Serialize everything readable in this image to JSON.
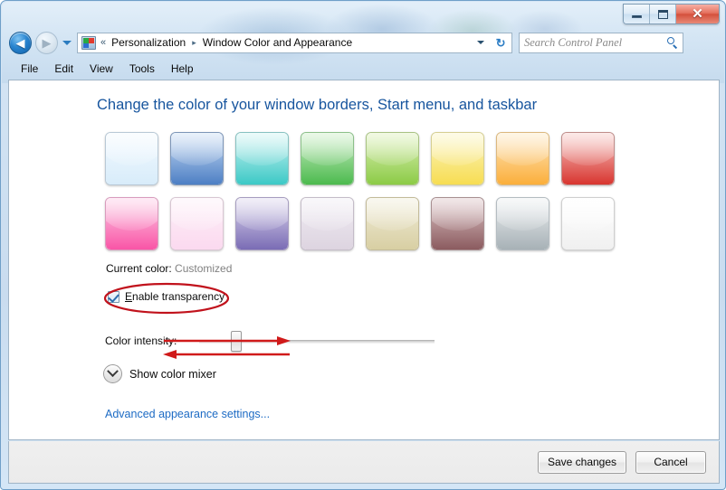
{
  "window": {
    "title_icon": "display-icon",
    "minimize_label": "Minimize",
    "maximize_label": "Maximize",
    "close_label": "Close"
  },
  "nav": {
    "back_glyph": "◀",
    "forward_glyph": "▶",
    "breadcrumb_chevrons": "«",
    "breadcrumbs": [
      {
        "label": "Personalization"
      },
      {
        "label": "Window Color and Appearance"
      }
    ],
    "separator": "▸",
    "refresh_glyph": "↻"
  },
  "search": {
    "placeholder": "Search Control Panel"
  },
  "menubar": {
    "items": [
      {
        "label": "File"
      },
      {
        "label": "Edit"
      },
      {
        "label": "View"
      },
      {
        "label": "Tools"
      },
      {
        "label": "Help"
      }
    ]
  },
  "main": {
    "heading": "Change the color of your window borders, Start menu, and taskbar",
    "current_color_label": "Current color:",
    "current_color_value": "Customized",
    "enable_transparency_label_pre": "E",
    "enable_transparency_label_post": "nable transparency",
    "enable_transparency_checked": true,
    "color_intensity_label": "Color intensity:",
    "color_intensity_percent": 14,
    "show_color_mixer_label": "Show color mixer",
    "advanced_link_label": "Advanced appearance settings..."
  },
  "swatches": [
    {
      "name": "swatch-sky",
      "top": "#f2f9fe",
      "bottom": "#d8ecfa",
      "border": "#b9c9d6"
    },
    {
      "name": "swatch-blue",
      "top": "#c8dcf4",
      "bottom": "#4d7fc4",
      "border": "#7d96b8"
    },
    {
      "name": "swatch-teal",
      "top": "#cdf3f2",
      "bottom": "#3cc9c6",
      "border": "#87c2c1"
    },
    {
      "name": "swatch-green",
      "top": "#cbeec4",
      "bottom": "#4cba4e",
      "border": "#8cc08a"
    },
    {
      "name": "swatch-lime",
      "top": "#dcf0b7",
      "bottom": "#8ccb46",
      "border": "#a9c383"
    },
    {
      "name": "swatch-yellow",
      "top": "#fbf5c2",
      "bottom": "#f7dd52",
      "border": "#d6cf92"
    },
    {
      "name": "swatch-orange",
      "top": "#fde8c0",
      "bottom": "#fbaf3b",
      "border": "#dcb87e"
    },
    {
      "name": "swatch-red",
      "top": "#f7c8c5",
      "bottom": "#d8352f",
      "border": "#c08e8b"
    },
    {
      "name": "swatch-pink",
      "top": "#fccde7",
      "bottom": "#f955a6",
      "border": "#d99cbd"
    },
    {
      "name": "swatch-lightpink",
      "top": "#fdf0f8",
      "bottom": "#fbd9ef",
      "border": "#d8c6d2"
    },
    {
      "name": "swatch-violet",
      "top": "#ddd7ee",
      "bottom": "#7a6cb5",
      "border": "#a69dc0"
    },
    {
      "name": "swatch-lavender",
      "top": "#f0ecf3",
      "bottom": "#ddd4e0",
      "border": "#c4bcc8"
    },
    {
      "name": "swatch-khaki",
      "top": "#f0ecd8",
      "bottom": "#d8cfa3",
      "border": "#c3bb99"
    },
    {
      "name": "swatch-mauve",
      "top": "#ddc4c6",
      "bottom": "#8b5b5f",
      "border": "#a88f91"
    },
    {
      "name": "swatch-gray",
      "top": "#eceff1",
      "bottom": "#a7b1b6",
      "border": "#b4bcc1"
    },
    {
      "name": "swatch-white",
      "top": "#ffffff",
      "bottom": "#f0f0f0",
      "border": "#cfcfcf"
    }
  ],
  "footer": {
    "save_label": "Save changes",
    "cancel_label": "Cancel"
  },
  "annotations": {
    "ellipse_color": "#c1121c",
    "arrow_color": "#d01a1a"
  }
}
